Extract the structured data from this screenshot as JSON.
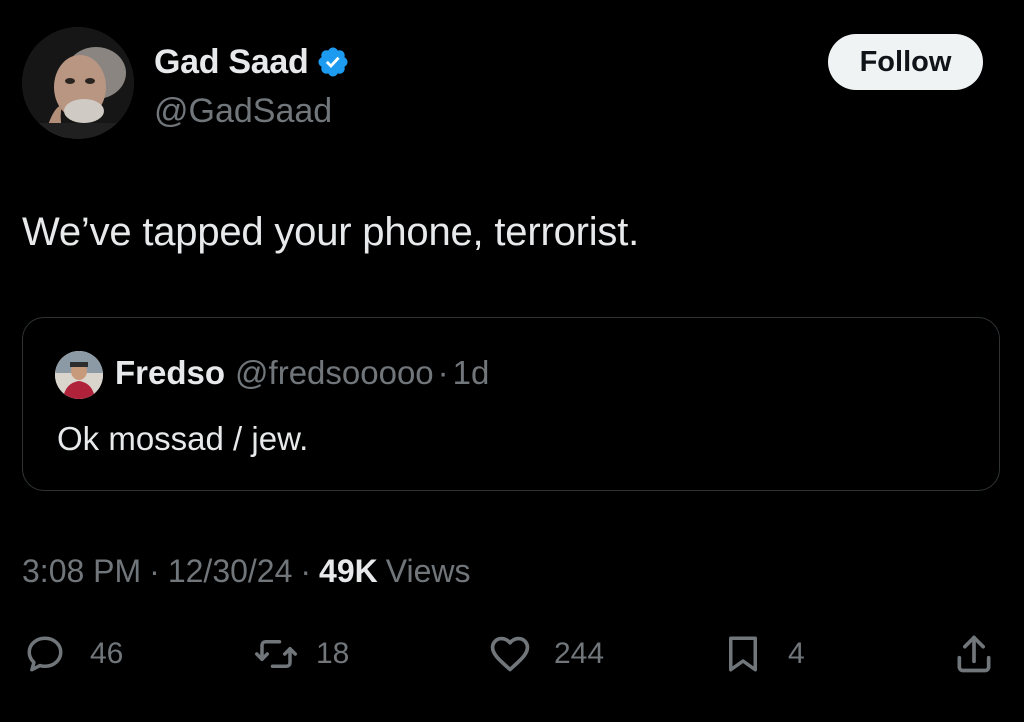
{
  "author": {
    "name": "Gad Saad",
    "handle": "@GadSaad",
    "verified": true
  },
  "follow_button": {
    "label": "Follow"
  },
  "tweet": {
    "text": "We’ve tapped your phone, terrorist."
  },
  "quoted_tweet": {
    "name": "Fredso",
    "handle": "@fredsooooo",
    "separator": "·",
    "time": "1d",
    "text": "Ok mossad / jew."
  },
  "meta": {
    "time": "3:08 PM",
    "separator": "·",
    "date": "12/30/24",
    "views_count": "49K",
    "views_label": "Views"
  },
  "actions": {
    "replies": "46",
    "reposts": "18",
    "likes": "244",
    "bookmarks": "4"
  },
  "colors": {
    "background": "#000000",
    "text_primary": "#e7e9ea",
    "text_secondary": "#71767b",
    "border": "#2f3336",
    "verified_blue": "#1d9bf0",
    "follow_button_bg": "#eff3f4"
  },
  "icons": {
    "verified": "verified-badge-icon",
    "reply": "reply-icon",
    "repost": "repost-icon",
    "like": "heart-icon",
    "bookmark": "bookmark-icon",
    "share": "share-icon"
  }
}
